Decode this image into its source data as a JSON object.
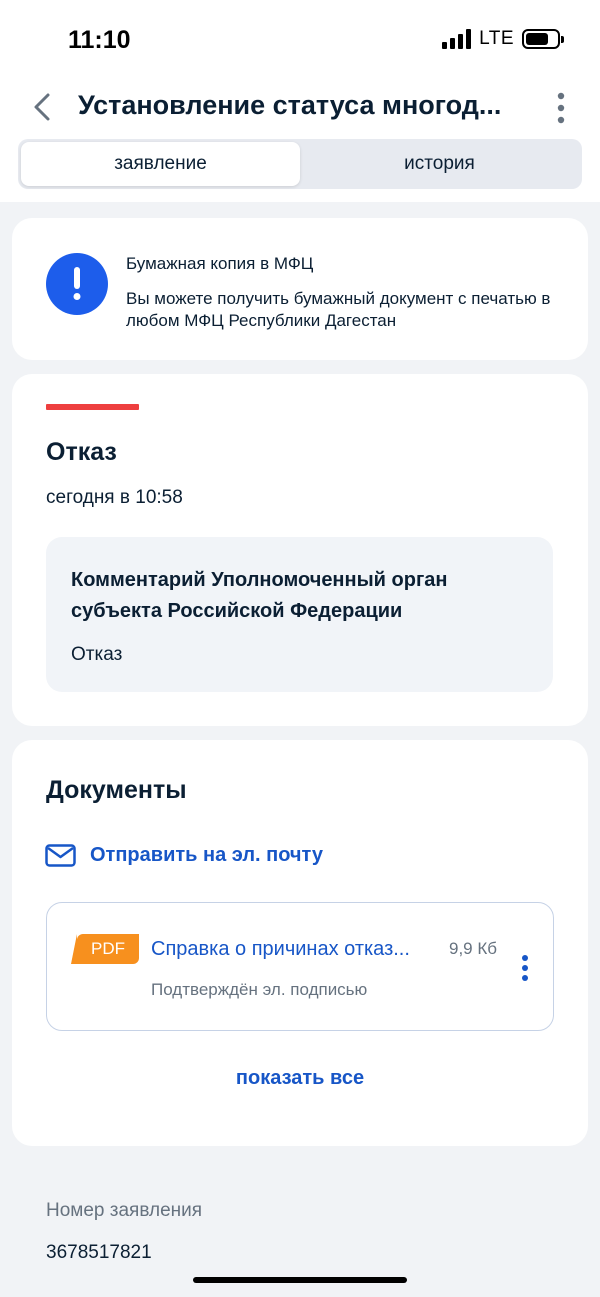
{
  "status_bar": {
    "time": "11:10",
    "network": "LTE"
  },
  "header": {
    "title": "Установление статуса многод..."
  },
  "tabs": [
    {
      "label": "заявление",
      "active": true
    },
    {
      "label": "история",
      "active": false
    }
  ],
  "info_card": {
    "icon": "exclamation-icon",
    "title": "Бумажная копия в МФЦ",
    "text": "Вы можете получить бумажный документ с печатью в любом МФЦ Республики Дагестан"
  },
  "status_card": {
    "title": "Отказ",
    "time": "сегодня в 10:58",
    "comment_title": "Комментарий Уполномоченный орган субъекта Российской Федерации",
    "comment_text": "Отказ"
  },
  "documents": {
    "title": "Документы",
    "email_link": "Отправить на эл. почту",
    "items": [
      {
        "badge": "PDF",
        "name": "Справка о причинах отказ...",
        "size": "9,9 Кб",
        "signature": "Подтверждён эл. подписью"
      }
    ],
    "show_all": "показать все"
  },
  "application": {
    "number_label": "Номер заявления",
    "number": "3678517821"
  },
  "colors": {
    "accent_blue": "#1d5deb",
    "link_blue": "#1756c7",
    "status_red": "#ee3f3f",
    "pdf_orange": "#f7901e",
    "background": "#f1f3f6"
  }
}
